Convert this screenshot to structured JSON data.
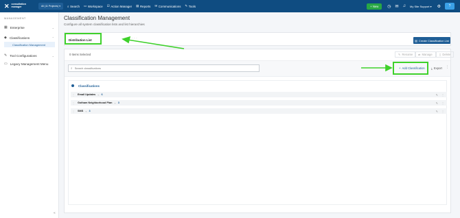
{
  "app": {
    "logo_line1": "consultation",
    "logo_line2": "manager",
    "project_selector": "All (11 Projects)"
  },
  "nav": [
    {
      "icon": "search-icon",
      "label": "Search"
    },
    {
      "icon": "workspace-icon",
      "label": "Workspace"
    },
    {
      "icon": "action-icon",
      "label": "Action Manager"
    },
    {
      "icon": "reports-icon",
      "label": "Reports"
    },
    {
      "icon": "communications-icon",
      "label": "Communications"
    },
    {
      "icon": "tools-icon",
      "label": "Tools"
    }
  ],
  "topright": {
    "new_label": "+ New",
    "user_label": "My Site Support ▾"
  },
  "sidebar": {
    "header": "MANAGEMENT",
    "items": [
      {
        "label": "Enterprise"
      },
      {
        "label": "Classifications"
      },
      {
        "label": "Classification Management"
      },
      {
        "label": "Tool Configurations"
      },
      {
        "label": "Legacy Management Menu"
      }
    ]
  },
  "page": {
    "title": "Classification Management",
    "subtitle": "Configure all system classification lists and list hierarchies"
  },
  "tabs": {
    "distribution_list": "Distribution List",
    "create_button": "Create Classification List"
  },
  "list": {
    "selected_count": "0 Items Selected",
    "rename": "Rename",
    "manage": "Manage",
    "delete": "Delete",
    "search_placeholder": "Search classifications",
    "add_classification": "Add Classification",
    "export": "Export",
    "root_label": "Classifications",
    "rows": [
      {
        "name": "Email Updates",
        "count": "6"
      },
      {
        "name": "Gotham Neighborhood Plan",
        "count": "3"
      },
      {
        "name": "SMS",
        "count": "3"
      }
    ]
  },
  "colors": {
    "topbar": "#0f4c81",
    "accent": "#1f5e96",
    "highlight": "#3ed12a",
    "new_button": "#28a745"
  }
}
